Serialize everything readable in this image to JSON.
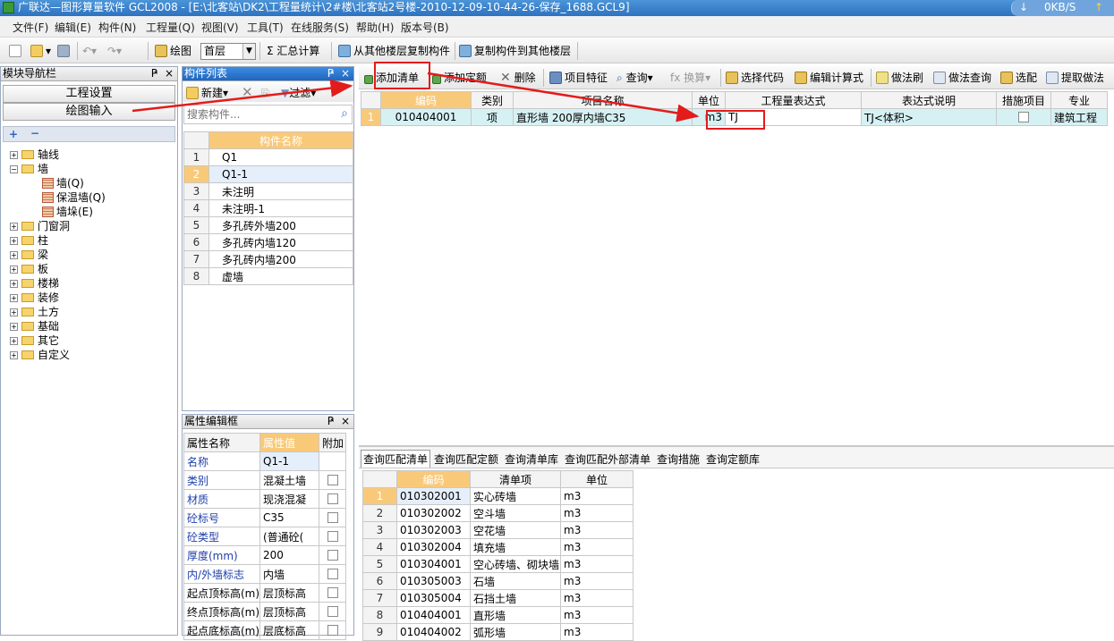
{
  "window": {
    "title": "广联达—图形算量软件 GCL2008 - [E:\\北客站\\DK2\\工程量统计\\2#楼\\北客站2号楼-2010-12-09-10-44-26-保存_1688.GCL9]",
    "net_speed": "0KB/S",
    "down_arrow": "↓",
    "up_arrow": "↑"
  },
  "menu": [
    "文件(F)",
    "编辑(E)",
    "构件(N)",
    "工程量(Q)",
    "视图(V)",
    "工具(T)",
    "在线服务(S)",
    "帮助(H)",
    "版本号(B)"
  ],
  "toolbar1": {
    "draw": "绘图",
    "floor": "首层",
    "sum_label": "Σ 汇总计算",
    "copy_from": "从其他楼层复制构件",
    "copy_to": "复制构件到其他楼层"
  },
  "nav": {
    "title": "模块导航栏",
    "btn_project": "工程设置",
    "btn_draw": "绘图输入",
    "tree": [
      "轴线",
      "墙",
      "墙(Q)",
      "保温墙(Q)",
      "墙垛(E)",
      "门窗洞",
      "柱",
      "梁",
      "板",
      "楼梯",
      "装修",
      "土方",
      "基础",
      "其它",
      "自定义"
    ]
  },
  "comp_list": {
    "title": "构件列表",
    "new_label": "新建",
    "filter_label": "过滤",
    "search_placeholder": "搜索构件...",
    "col_name": "构件名称",
    "rows": [
      {
        "no": "1",
        "name": "Q1"
      },
      {
        "no": "2",
        "name": "Q1-1"
      },
      {
        "no": "3",
        "name": "未注明"
      },
      {
        "no": "4",
        "name": "未注明-1"
      },
      {
        "no": "5",
        "name": "多孔砖外墙200"
      },
      {
        "no": "6",
        "name": "多孔砖内墙120"
      },
      {
        "no": "7",
        "name": "多孔砖内墙200"
      },
      {
        "no": "8",
        "name": "虚墙"
      }
    ]
  },
  "props": {
    "title": "属性编辑框",
    "col_name": "属性名称",
    "col_value": "属性值",
    "col_extra": "附加",
    "rows": [
      {
        "name": "名称",
        "value": "Q1-1"
      },
      {
        "name": "类别",
        "value": "混凝土墙"
      },
      {
        "name": "材质",
        "value": "现浇混凝"
      },
      {
        "name": "砼标号",
        "value": "C35"
      },
      {
        "name": "砼类型",
        "value": "(普通砼("
      },
      {
        "name": "厚度(mm)",
        "value": "200"
      },
      {
        "name": "内/外墙标志",
        "value": "内墙"
      },
      {
        "name": "起点顶标高(m)",
        "value": "层顶标高"
      },
      {
        "name": "终点顶标高(m)",
        "value": "层顶标高"
      },
      {
        "name": "起点底标高(m)",
        "value": "层底标高"
      }
    ]
  },
  "toolbar2": {
    "add_list": "添加清单",
    "add_quota": "添加定额",
    "delete": "删除",
    "item_feature": "项目特征",
    "query": "查询",
    "convert": "换算",
    "select_code": "选择代码",
    "edit_formula": "编辑计算式",
    "method_brush": "做法刷",
    "method_query": "做法查询",
    "pick": "选配",
    "extract": "提取做法"
  },
  "main_grid": {
    "headers": [
      "编码",
      "类别",
      "项目名称",
      "单位",
      "工程量表达式",
      "表达式说明",
      "措施项目",
      "专业"
    ],
    "row": {
      "no": "1",
      "code": "010404001",
      "type": "项",
      "name": "直形墙 200厚内墙C35",
      "unit": "m3",
      "expr": "TJ",
      "desc": "TJ<体积>",
      "major": "建筑工程"
    }
  },
  "bottom": {
    "tabs": [
      "查询匹配清单",
      "查询匹配定额",
      "查询清单库",
      "查询匹配外部清单",
      "查询措施",
      "查询定额库"
    ],
    "headers": [
      "编码",
      "清单项",
      "单位"
    ],
    "rows": [
      {
        "no": "1",
        "code": "010302001",
        "item": "实心砖墙",
        "unit": "m3"
      },
      {
        "no": "2",
        "code": "010302002",
        "item": "空斗墙",
        "unit": "m3"
      },
      {
        "no": "3",
        "code": "010302003",
        "item": "空花墙",
        "unit": "m3"
      },
      {
        "no": "4",
        "code": "010302004",
        "item": "填充墙",
        "unit": "m3"
      },
      {
        "no": "5",
        "code": "010304001",
        "item": "空心砖墙、砌块墙",
        "unit": "m3"
      },
      {
        "no": "6",
        "code": "010305003",
        "item": "石墙",
        "unit": "m3"
      },
      {
        "no": "7",
        "code": "010305004",
        "item": "石挡土墙",
        "unit": "m3"
      },
      {
        "no": "8",
        "code": "010404001",
        "item": "直形墙",
        "unit": "m3"
      },
      {
        "no": "9",
        "code": "010404002",
        "item": "弧形墙",
        "unit": "m3"
      }
    ]
  },
  "colors": {
    "accent_orange": "#f9c97a",
    "annotation_red": "#e31b1b",
    "title_blue": "#2d72c0"
  }
}
